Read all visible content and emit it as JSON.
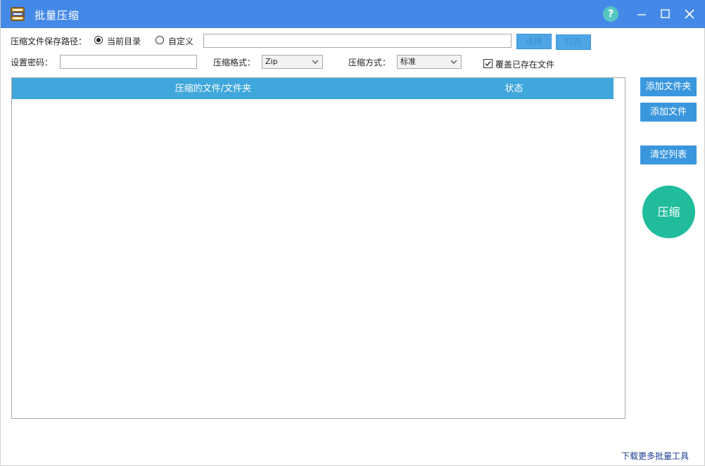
{
  "window": {
    "title": "批量压缩",
    "help_label": "?"
  },
  "save_path": {
    "label": "压缩文件保存路径：",
    "option_current": "当前目录",
    "option_custom": "自定义",
    "path_value": "",
    "browse_button": "选择",
    "open_button": "打开"
  },
  "options": {
    "password_label": "设置密码：",
    "password_value": "",
    "format_label": "压缩格式：",
    "format_value": "Zip",
    "method_label": "压缩方式：",
    "method_value": "标准",
    "overwrite_label": "覆盖已存在文件",
    "overwrite_checked": true
  },
  "list": {
    "columns": [
      "压缩的文件/文件夹",
      "状态"
    ],
    "rows": []
  },
  "actions": {
    "add_folder": "添加文件夹",
    "add_file": "添加文件",
    "clear_list": "清空列表",
    "compress": "压缩"
  },
  "footer": {
    "more_tools_link": "下载更多批量工具"
  },
  "colors": {
    "titlebar": "#4589e8",
    "list_header": "#3fa7db",
    "side_button": "#3a97de",
    "compress_button": "#20bc9b",
    "help_button": "#55c6c1"
  },
  "icons": {
    "app": "compress-app-icon",
    "help": "help-icon",
    "minimize": "minimize-icon",
    "maximize": "maximize-icon",
    "close": "close-icon",
    "dropdown": "chevron-down-icon",
    "check": "checkmark-icon"
  }
}
